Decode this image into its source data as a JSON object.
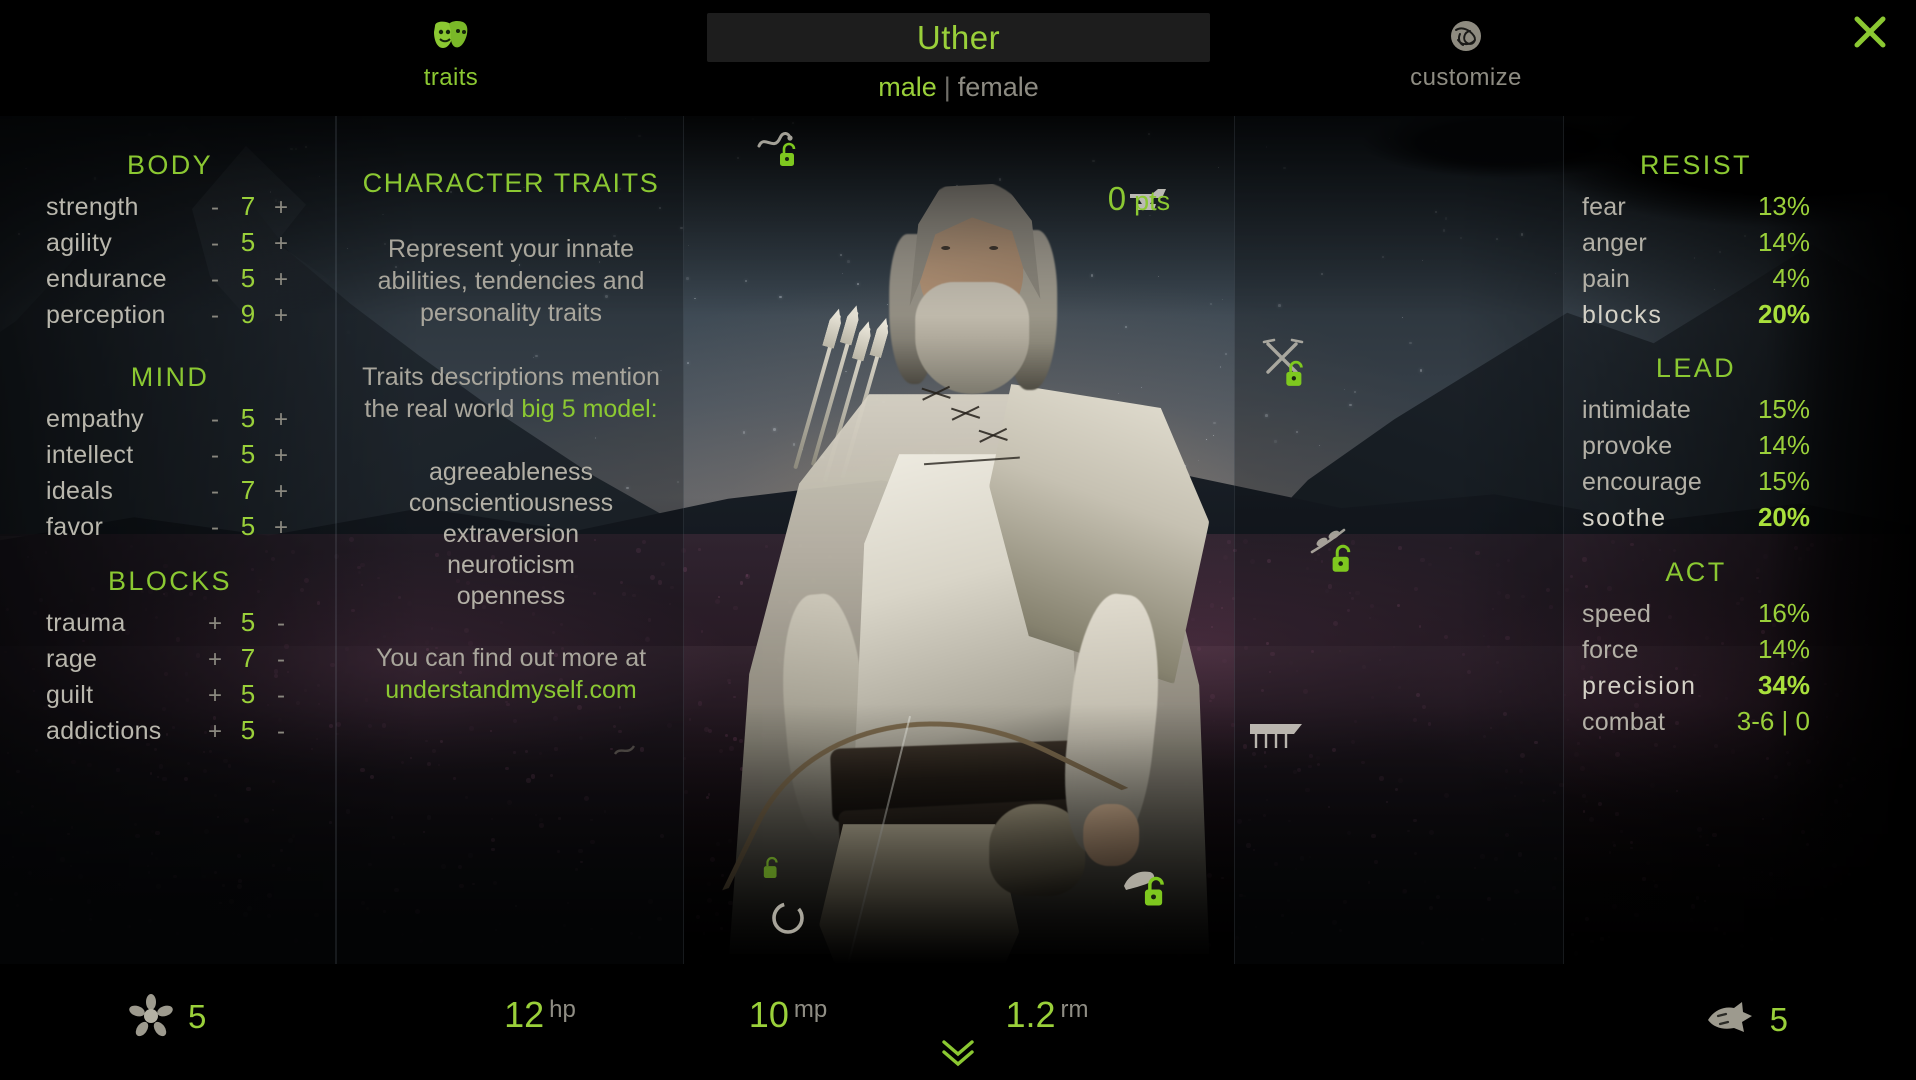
{
  "header": {
    "tabs": [
      {
        "label": "traits",
        "icon": "theatre-masks-icon",
        "active": true
      },
      {
        "label": "customize",
        "icon": "celtic-knot-icon",
        "active": false
      }
    ],
    "name_value": "Uther",
    "gender": {
      "male": "male",
      "separator": "|",
      "female": "female",
      "selected": "male"
    },
    "close_icon": "close-icon"
  },
  "points": {
    "value": "0",
    "unit": "pts"
  },
  "attributes": {
    "body": {
      "title": "BODY",
      "rows": [
        {
          "name": "strength",
          "dec": "-",
          "value": "7",
          "inc": "+"
        },
        {
          "name": "agility",
          "dec": "-",
          "value": "5",
          "inc": "+"
        },
        {
          "name": "endurance",
          "dec": "-",
          "value": "5",
          "inc": "+"
        },
        {
          "name": "perception",
          "dec": "-",
          "value": "9",
          "inc": "+"
        }
      ]
    },
    "mind": {
      "title": "MIND",
      "rows": [
        {
          "name": "empathy",
          "dec": "-",
          "value": "5",
          "inc": "+"
        },
        {
          "name": "intellect",
          "dec": "-",
          "value": "5",
          "inc": "+"
        },
        {
          "name": "ideals",
          "dec": "-",
          "value": "7",
          "inc": "+"
        },
        {
          "name": "favor",
          "dec": "-",
          "value": "5",
          "inc": "+"
        }
      ]
    },
    "blocks": {
      "title": "BLOCKS",
      "rows": [
        {
          "name": "trauma",
          "dec": "+",
          "value": "5",
          "inc": "-"
        },
        {
          "name": "rage",
          "dec": "+",
          "value": "7",
          "inc": "-"
        },
        {
          "name": "guilt",
          "dec": "+",
          "value": "5",
          "inc": "-"
        },
        {
          "name": "addictions",
          "dec": "+",
          "value": "5",
          "inc": "-"
        }
      ]
    }
  },
  "traits_panel": {
    "title": "CHARACTER TRAITS",
    "para1_line1": "Represent your innate",
    "para1_line2": "abilities, tendencies and",
    "para1_line3": "personality traits",
    "para2_line1": "Traits descriptions mention",
    "para2_line2_prefix": "the real world ",
    "para2_line2_highlight": "big 5 model:",
    "list": [
      "agreeableness",
      "conscientiousness",
      "extraversion",
      "neuroticism",
      "openness"
    ],
    "footer_text": "You can find out more at",
    "footer_link": "understandmyself.com"
  },
  "skills": {
    "resist": {
      "title": "RESIST",
      "rows": [
        {
          "name": "fear",
          "value": "13%",
          "strong": false
        },
        {
          "name": "anger",
          "value": "14%",
          "strong": false
        },
        {
          "name": "pain",
          "value": "4%",
          "strong": false
        },
        {
          "name": "blocks",
          "value": "20%",
          "strong": true
        }
      ]
    },
    "lead": {
      "title": "LEAD",
      "rows": [
        {
          "name": "intimidate",
          "value": "15%",
          "strong": false
        },
        {
          "name": "provoke",
          "value": "14%",
          "strong": false
        },
        {
          "name": "encourage",
          "value": "15%",
          "strong": false
        },
        {
          "name": "soothe",
          "value": "20%",
          "strong": true
        }
      ]
    },
    "act": {
      "title": "ACT",
      "rows": [
        {
          "name": "speed",
          "value": "16%",
          "strong": false
        },
        {
          "name": "force",
          "value": "14%",
          "strong": false
        },
        {
          "name": "precision",
          "value": "34%",
          "strong": true
        },
        {
          "name": "combat",
          "value": "3-6 | 0",
          "strong": false
        }
      ]
    }
  },
  "vitals": [
    {
      "value": "12",
      "unit": "hp"
    },
    {
      "value": "10",
      "unit": "mp"
    },
    {
      "value": "1.2",
      "unit": "rm"
    }
  ],
  "corner_badges": {
    "left": {
      "icon": "flower-icon",
      "value": "5"
    },
    "right": {
      "icon": "wolf-head-icon",
      "value": "5"
    }
  },
  "markers": [
    {
      "icon": "snake-icon",
      "lock": "unlocked-padlock-icon"
    },
    {
      "icon": "anvil-icon",
      "lock": "none"
    },
    {
      "icon": "crossed-swords-icon",
      "lock": "unlocked-padlock-icon"
    },
    {
      "icon": "leaf-branch-icon",
      "lock": "unlocked-padlock-icon"
    },
    {
      "icon": "banner-icon",
      "lock": "none"
    },
    {
      "icon": "hand-icon",
      "lock": "unlocked-padlock-icon"
    },
    {
      "icon": "ring-icon",
      "lock": "none"
    }
  ],
  "scroll_down_icon": "double-chevron-down-icon",
  "colors": {
    "accent_green": "#8bc832",
    "value_green": "#9ad03a",
    "muted_text": "#b3b0a6",
    "background": "#000000"
  }
}
